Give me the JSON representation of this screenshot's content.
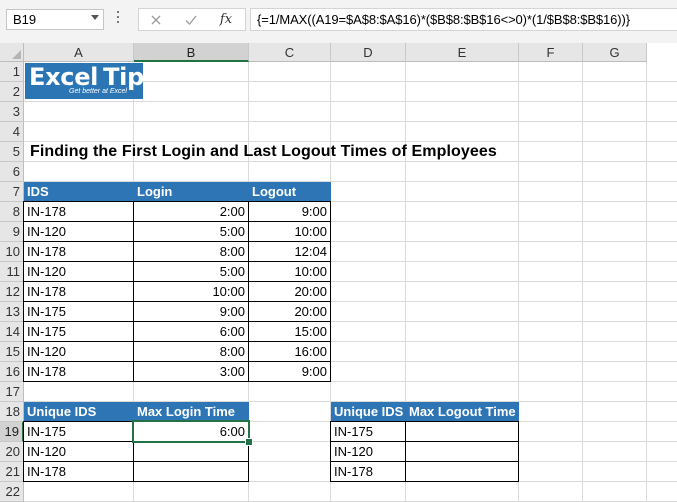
{
  "formula_bar": {
    "name_box": "B19",
    "fx_label": "fx",
    "formula": "{=1/MAX((A19=$A$8:$A$16)*($B$8:$B$16<>0)*(1/$B$8:$B$16))}"
  },
  "columns": [
    "A",
    "B",
    "C",
    "D",
    "E",
    "F",
    "G"
  ],
  "rows": [
    "1",
    "2",
    "3",
    "4",
    "5",
    "6",
    "7",
    "8",
    "9",
    "10",
    "11",
    "12",
    "13",
    "14",
    "15",
    "16",
    "17",
    "18",
    "19",
    "20",
    "21",
    "22"
  ],
  "logo": {
    "brand_word1": "Excel",
    "brand_word2": "Tip",
    "tagline": "Get better at Excel"
  },
  "sheet": {
    "title": "Finding the First Login and Last Logout Times of Employees",
    "table1": {
      "headers": [
        "IDS",
        "Login",
        "Logout"
      ],
      "rows": [
        [
          "IN-178",
          "2:00",
          "9:00"
        ],
        [
          "IN-120",
          "5:00",
          "10:00"
        ],
        [
          "IN-178",
          "8:00",
          "12:04"
        ],
        [
          "IN-120",
          "5:00",
          "10:00"
        ],
        [
          "IN-178",
          "10:00",
          "20:00"
        ],
        [
          "IN-175",
          "9:00",
          "20:00"
        ],
        [
          "IN-175",
          "6:00",
          "15:00"
        ],
        [
          "IN-120",
          "8:00",
          "16:00"
        ],
        [
          "IN-178",
          "3:00",
          "9:00"
        ]
      ]
    },
    "table2": {
      "headers": [
        "Unique IDS",
        "Max Login Time"
      ],
      "rows": [
        [
          "IN-175",
          "6:00"
        ],
        [
          "IN-120",
          ""
        ],
        [
          "IN-178",
          ""
        ]
      ]
    },
    "table3": {
      "headers": [
        "Unique IDS",
        "Max Logout Time"
      ],
      "rows": [
        [
          "IN-175",
          ""
        ],
        [
          "IN-120",
          ""
        ],
        [
          "IN-178",
          ""
        ]
      ]
    }
  },
  "selected_cell": "B19",
  "colors": {
    "header_fill": "#2e75b6",
    "selection": "#217346"
  }
}
